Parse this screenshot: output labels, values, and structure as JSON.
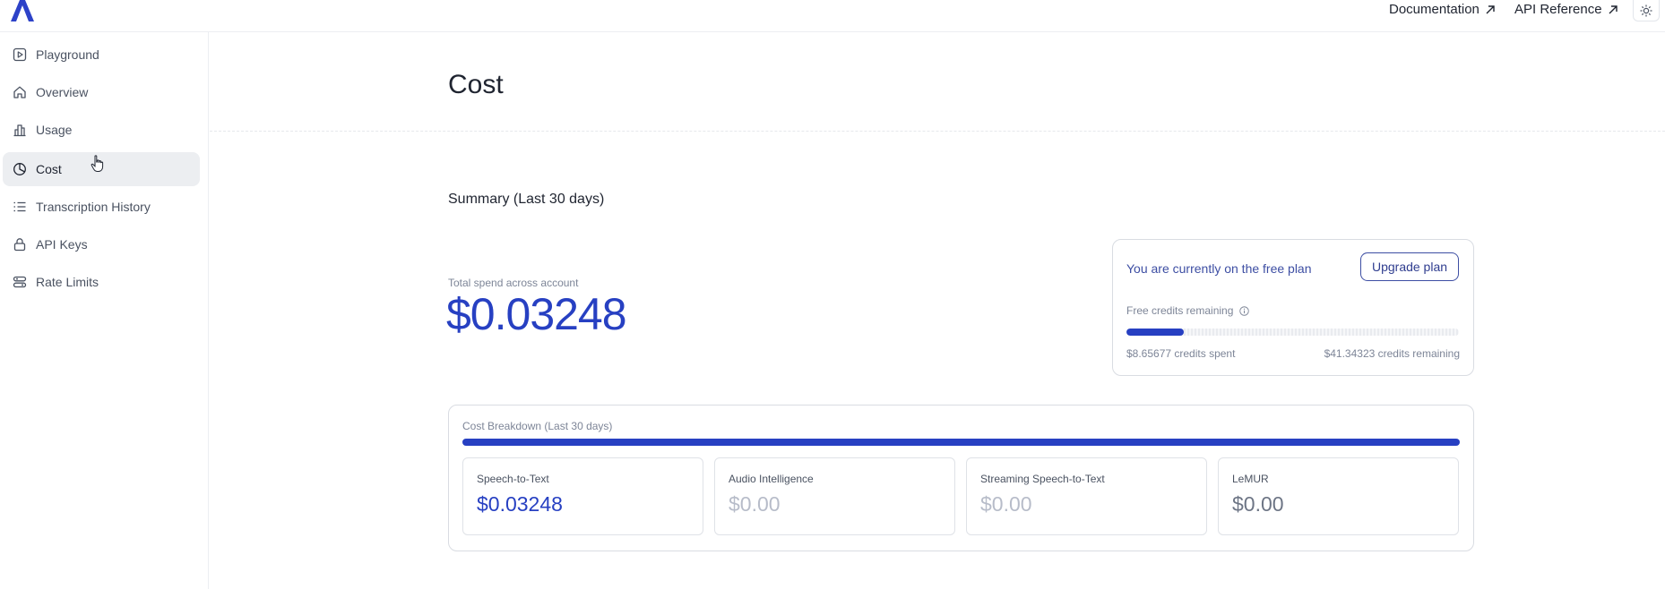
{
  "topbar": {
    "documentation_label": "Documentation",
    "api_reference_label": "API Reference"
  },
  "sidebar": {
    "items": [
      {
        "label": "Playground",
        "icon": "play-square-icon"
      },
      {
        "label": "Overview",
        "icon": "home-icon"
      },
      {
        "label": "Usage",
        "icon": "bar-chart-icon"
      },
      {
        "label": "Cost",
        "icon": "pie-chart-icon",
        "active": true
      },
      {
        "label": "Transcription History",
        "icon": "list-icon"
      },
      {
        "label": "API Keys",
        "icon": "lock-icon"
      },
      {
        "label": "Rate Limits",
        "icon": "sliders-icon"
      }
    ]
  },
  "main": {
    "title": "Cost",
    "summary_title": "Summary (Last 30 days)",
    "total_spend_label": "Total spend across account",
    "total_spend_value": "$0.03248",
    "plan": {
      "text": "You are currently on the free plan",
      "upgrade_label": "Upgrade plan",
      "credits_label": "Free credits remaining",
      "credits_spent": "$8.65677 credits spent",
      "credits_remaining": "$41.34323 credits remaining",
      "credits_used_fraction": 0.173
    },
    "breakdown": {
      "title": "Cost Breakdown (Last 30 days)",
      "bar_fraction": 1.0,
      "items": [
        {
          "name": "Speech-to-Text",
          "value": "$0.03248",
          "color": "#2740c2"
        },
        {
          "name": "Audio Intelligence",
          "value": "$0.00",
          "color": "#b7bcc9"
        },
        {
          "name": "Streaming Speech-to-Text",
          "value": "$0.00",
          "color": "#b7bcc9"
        },
        {
          "name": "LeMUR",
          "value": "$0.00",
          "color": "#6d7585"
        }
      ]
    }
  },
  "colors": {
    "accent": "#2740c2",
    "plan_text": "#3d4ea3"
  }
}
